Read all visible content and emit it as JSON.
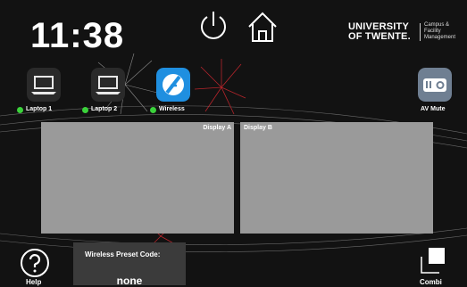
{
  "colors": {
    "background": "#121212",
    "display_area": "#9a9a9a",
    "active_source": "#1f8fe0",
    "status_dot": "#3bd23b",
    "preset_panel": "#3b3b3b"
  },
  "header": {
    "clock": "11:38",
    "power_icon": "power-icon",
    "home_icon": "home-icon",
    "logo": {
      "university_line1": "UNIVERSITY",
      "university_line2": "OF TWENTE.",
      "dept_line1": "Campus & Facility",
      "dept_line2": "Management"
    }
  },
  "sources": [
    {
      "label": "Laptop 1",
      "icon": "laptop-icon",
      "connected": true
    },
    {
      "label": "Laptop 2",
      "icon": "laptop-icon",
      "connected": true
    },
    {
      "label": "Wireless",
      "icon": "wireless-icon",
      "connected": true,
      "active": true
    }
  ],
  "av_mute": {
    "label": "AV Mute",
    "icon": "projector-icon"
  },
  "displays": [
    {
      "label": "Display A"
    },
    {
      "label": "Display B"
    }
  ],
  "footer": {
    "help_label": "Help",
    "preset_title": "Wireless Preset Code:",
    "preset_value": "none",
    "combi_label": "Combi"
  }
}
